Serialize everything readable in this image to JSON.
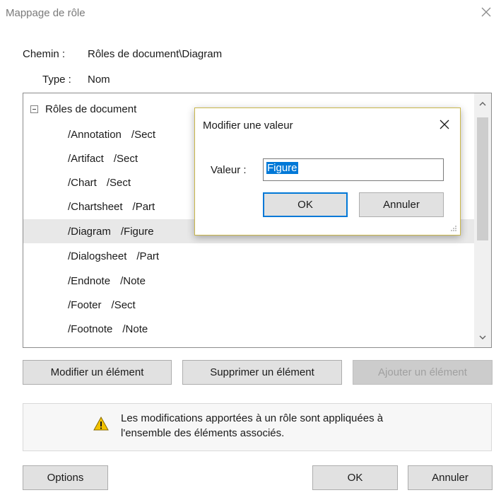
{
  "window": {
    "title": "Mappage de rôle"
  },
  "fields": {
    "path_label": "Chemin :",
    "path_value": "Rôles de document\\Diagram",
    "type_label": "Type :",
    "type_value": "Nom"
  },
  "tree": {
    "root_label": "Rôles de document",
    "items": [
      {
        "role": "/Annotation",
        "map": "/Sect",
        "selected": false
      },
      {
        "role": "/Artifact",
        "map": "/Sect",
        "selected": false
      },
      {
        "role": "/Chart",
        "map": "/Sect",
        "selected": false
      },
      {
        "role": "/Chartsheet",
        "map": "/Part",
        "selected": false
      },
      {
        "role": "/Diagram",
        "map": "/Figure",
        "selected": true
      },
      {
        "role": "/Dialogsheet",
        "map": "/Part",
        "selected": false
      },
      {
        "role": "/Endnote",
        "map": "/Note",
        "selected": false
      },
      {
        "role": "/Footer",
        "map": "/Sect",
        "selected": false
      },
      {
        "role": "/Footnote",
        "map": "/Note",
        "selected": false
      }
    ]
  },
  "buttons": {
    "edit": "Modifier un élément",
    "delete": "Supprimer un élément",
    "add": "Ajouter un élément",
    "options": "Options",
    "ok": "OK",
    "cancel": "Annuler"
  },
  "note": {
    "line1": "Les modifications apportées à un rôle sont appliquées à",
    "line2": "l'ensemble des éléments associés."
  },
  "modal": {
    "title": "Modifier une valeur",
    "value_label": "Valeur :",
    "value": "Figure",
    "ok": "OK",
    "cancel": "Annuler"
  },
  "colors": {
    "accent": "#0078d7",
    "warning": "#f2c200"
  }
}
